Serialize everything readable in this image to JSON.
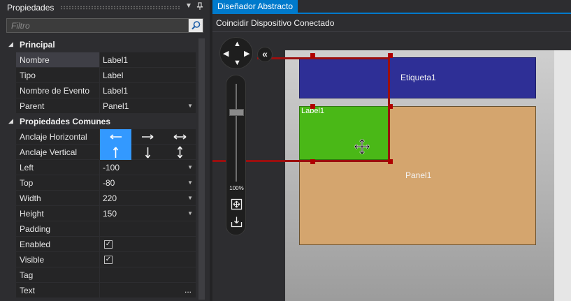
{
  "properties": {
    "title": "Propiedades",
    "filter_placeholder": "Filtro",
    "categories": {
      "principal": "Principal",
      "comunes": "Propiedades Comunes"
    },
    "rows": {
      "nombre": {
        "name": "Nombre",
        "value": "Label1"
      },
      "tipo": {
        "name": "Tipo",
        "value": "Label"
      },
      "evento": {
        "name": "Nombre de Evento",
        "value": "Label1"
      },
      "parent": {
        "name": "Parent",
        "value": "Panel1"
      },
      "anclaje_h": {
        "name": "Anclaje Horizontal"
      },
      "anclaje_v": {
        "name": "Anclaje Vertical"
      },
      "left": {
        "name": "Left",
        "value": "-100"
      },
      "top": {
        "name": "Top",
        "value": "-80"
      },
      "width": {
        "name": "Width",
        "value": "220"
      },
      "height": {
        "name": "Height",
        "value": "150"
      },
      "padding": {
        "name": "Padding",
        "value": ""
      },
      "enabled": {
        "name": "Enabled",
        "checked": true
      },
      "visible": {
        "name": "Visible",
        "checked": true
      },
      "tag": {
        "name": "Tag",
        "value": ""
      },
      "text": {
        "name": "Text",
        "value": "",
        "ellipsis": "..."
      }
    }
  },
  "designer": {
    "tab": "Diseñador Abstracto",
    "toolbar_label": "Coincidir Dispositivo Conectado",
    "zoom": "100%",
    "views": {
      "etiqueta": "Etiqueta1",
      "panel": "Panel1",
      "label": "Label1"
    }
  },
  "colors": {
    "accent": "#007acc",
    "selected_anchor": "#3399ff",
    "etiqueta_bg": "#2e2f96",
    "panel_bg": "#d4a56e",
    "label_bg": "#4ab817",
    "selection": "#9b0f0f"
  }
}
